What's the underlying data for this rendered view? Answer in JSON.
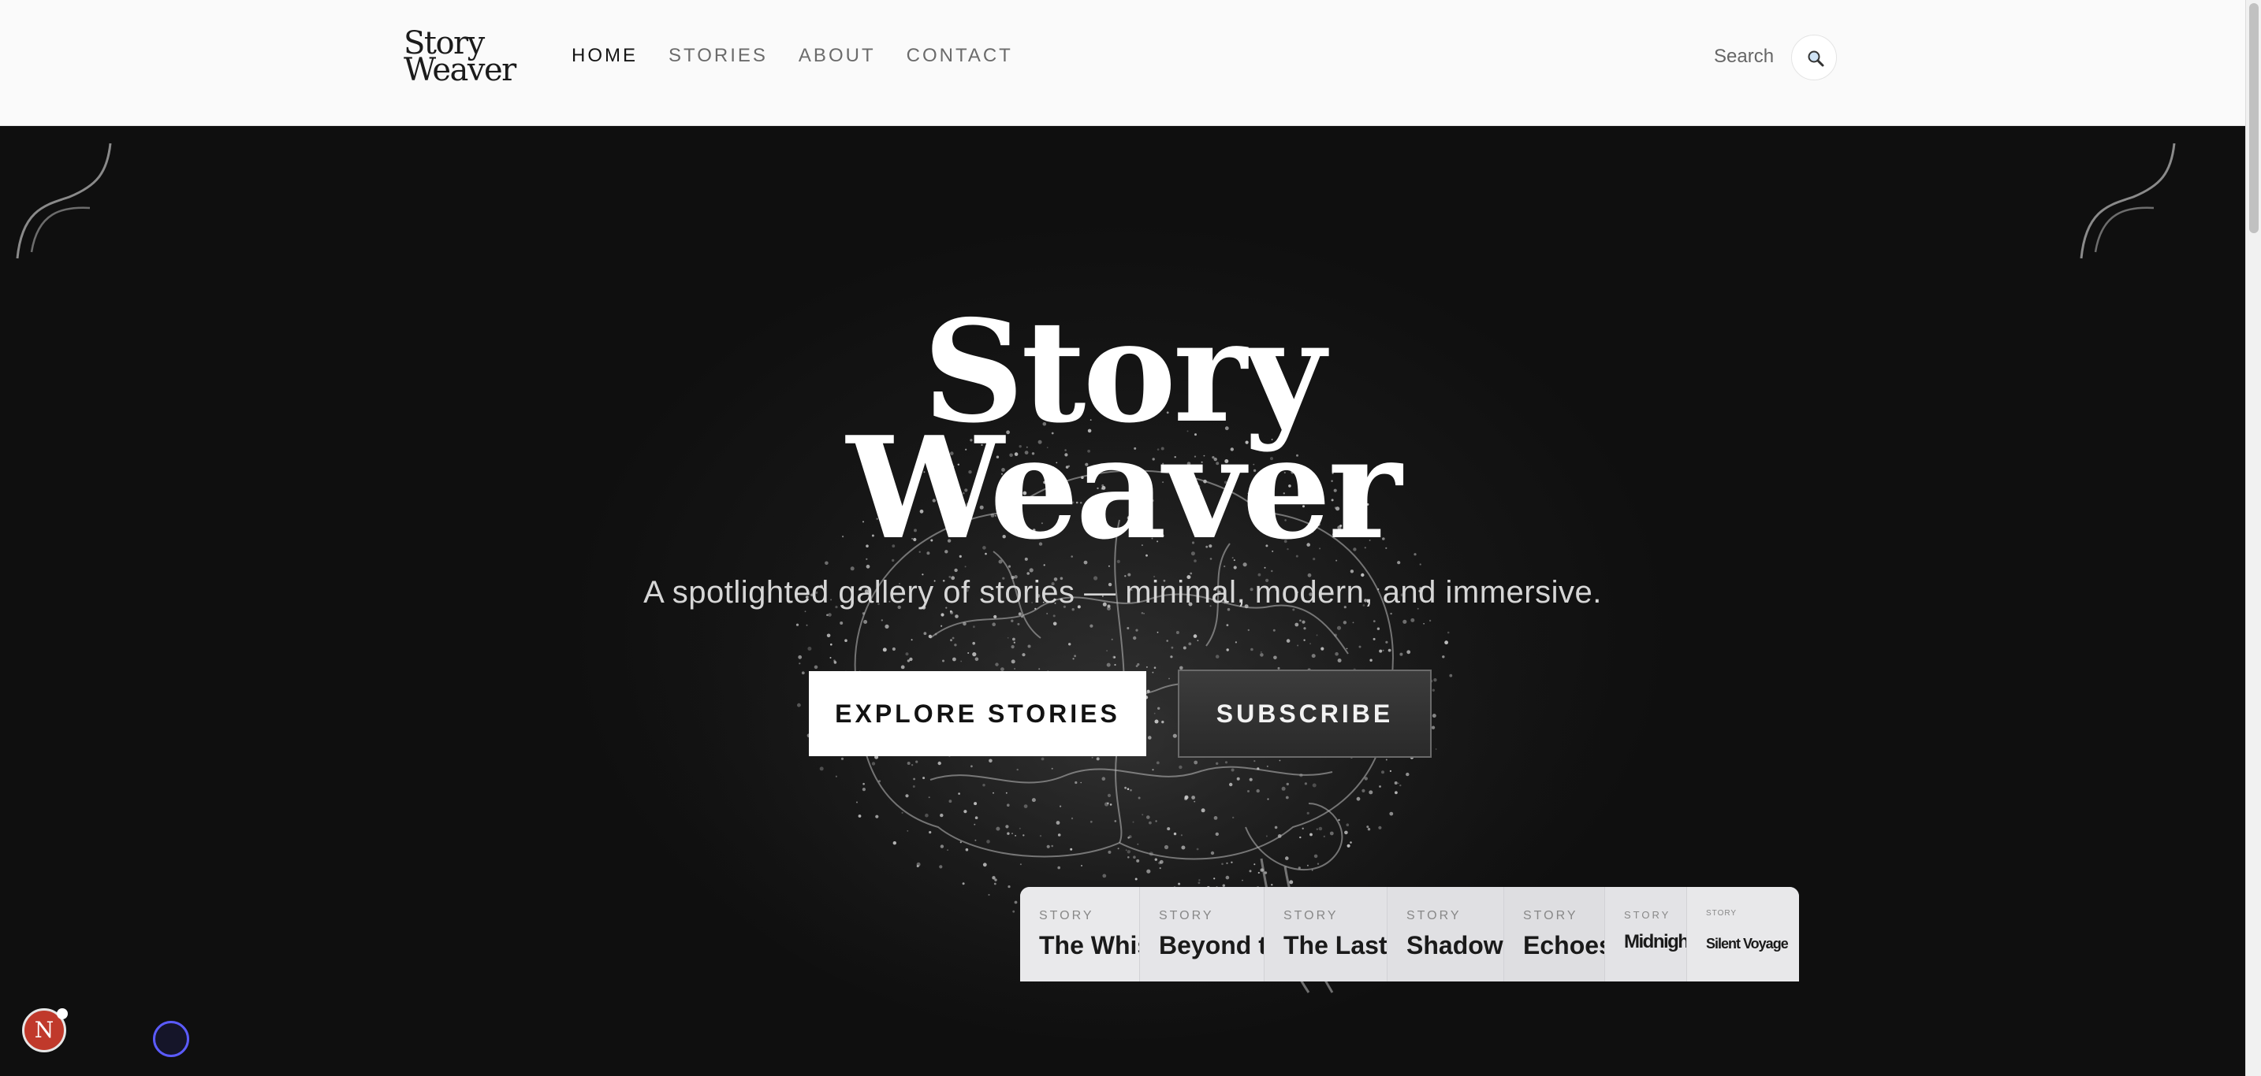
{
  "header": {
    "logo": {
      "line1": "Story",
      "line2": "Weaver"
    },
    "nav": [
      {
        "label": "HOME",
        "active": true
      },
      {
        "label": "STORIES",
        "active": false
      },
      {
        "label": "ABOUT",
        "active": false
      },
      {
        "label": "CONTACT",
        "active": false
      }
    ],
    "search_label": "Search",
    "search_icon": "magnifier-icon"
  },
  "hero": {
    "title_line1": "Story",
    "title_line2": "Weaver",
    "tagline": "A spotlighted gallery of stories — minimal, modern, and immersive.",
    "explore_label": "EXPLORE STORIES",
    "subscribe_label": "SUBSCRIBE",
    "background_image": "particle-brain-illustration"
  },
  "carousel": {
    "cards": [
      {
        "tag": "STORY",
        "title": "The Whispering Woods"
      },
      {
        "tag": "STORY",
        "title": "Beyond the Horizon"
      },
      {
        "tag": "STORY",
        "title": "The Last Lantern"
      },
      {
        "tag": "STORY",
        "title": "Shadows of Time"
      },
      {
        "tag": "STORY",
        "title": "Echoes in Silence"
      },
      {
        "tag": "STORY",
        "title": "Midnight Chronicles"
      },
      {
        "tag": "STORY",
        "title": "Silent Voyage"
      }
    ]
  },
  "floating": {
    "avatar_letter": "N"
  },
  "colors": {
    "header_bg": "#fafafa",
    "hero_bg": "#101010",
    "accent_ring": "#5b5bff",
    "avatar_bg": "#c0392b"
  }
}
